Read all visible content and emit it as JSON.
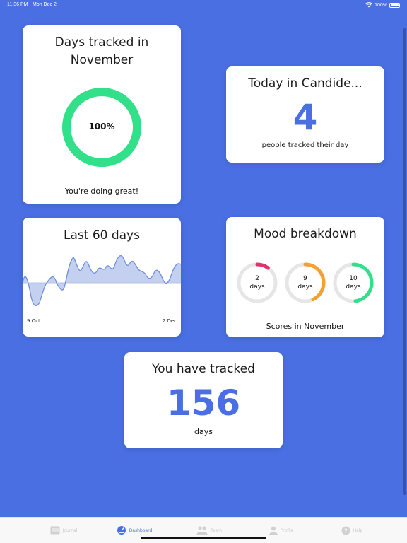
{
  "status_bar": {
    "time": "11:36 PM",
    "date": "Mon Dec 2",
    "battery": "100%"
  },
  "days_tracked_card": {
    "title_line1": "Days tracked in",
    "title_line2": "November",
    "percent": "100%",
    "progress": 1.0,
    "caption": "You're doing great!",
    "ring_color": "#33e08a"
  },
  "today_card": {
    "title": "Today in Candide...",
    "count": "4",
    "caption": "people tracked their day"
  },
  "last60_card": {
    "title": "Last 60 days",
    "start_label": "9 Oct",
    "end_label": "2 Dec"
  },
  "mood_card": {
    "title": "Mood breakdown",
    "rings": [
      {
        "num": "2",
        "unit": "days",
        "fraction": 0.1,
        "color": "#e0336b"
      },
      {
        "num": "9",
        "unit": "days",
        "fraction": 0.43,
        "color": "#f5a033"
      },
      {
        "num": "10",
        "unit": "days",
        "fraction": 0.48,
        "color": "#33e08a"
      }
    ],
    "caption": "Scores in November"
  },
  "total_card": {
    "title": "You have tracked",
    "count": "156",
    "unit": "days"
  },
  "tab_bar": {
    "tabs": [
      {
        "label": "Journal",
        "icon": "journal-icon"
      },
      {
        "label": "Dashboard",
        "icon": "dashboard-icon"
      },
      {
        "label": "Team",
        "icon": "team-icon"
      },
      {
        "label": "Profile",
        "icon": "profile-icon"
      },
      {
        "label": "Help",
        "icon": "help-icon"
      }
    ],
    "active_tab": "Dashboard"
  },
  "colors": {
    "background": "#4a6fe3",
    "accent": "#4a6fe3",
    "chart_line": "#6f8fd6",
    "chart_fill": "#c4d0ef"
  }
}
